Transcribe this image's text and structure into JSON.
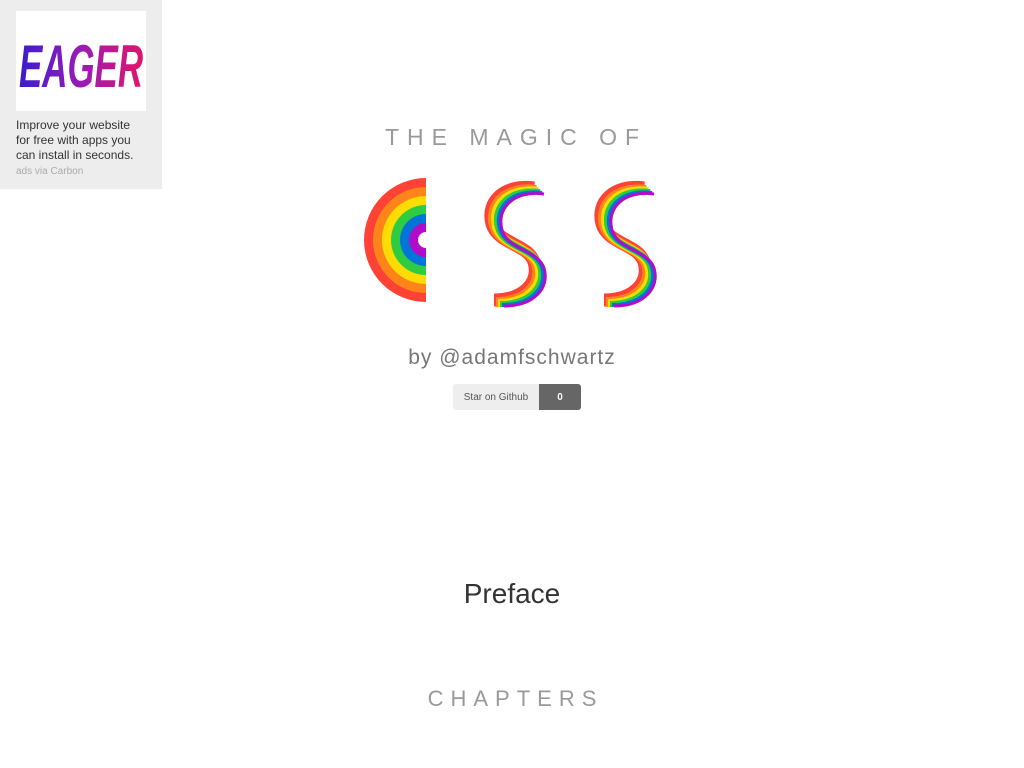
{
  "ad": {
    "brand": "EAGER",
    "text": "Improve your website for free with apps you can install in seconds.",
    "via": "ads via Carbon"
  },
  "hero": {
    "kicker": "THE MAGIC OF",
    "logo_text": "CSS",
    "byline": "by @adamfschwartz"
  },
  "github": {
    "label": "Star on Github",
    "count": "0"
  },
  "preface": {
    "title": "Preface"
  },
  "chapters": {
    "heading": "CHAPTERS"
  },
  "colors": {
    "rainbow": [
      "#ff4136",
      "#ff851b",
      "#ffdc00",
      "#2ecc40",
      "#0074d9",
      "#b10dc9"
    ]
  }
}
